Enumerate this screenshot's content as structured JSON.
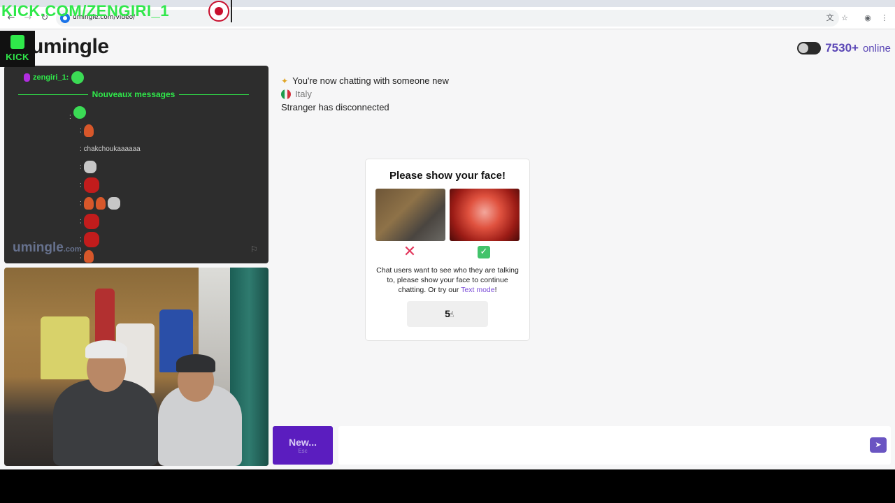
{
  "browser": {
    "url": "umingle.com/video/"
  },
  "stream_overlay": {
    "banner": "KICK.COM/ZENGIRI_1",
    "kick_logo": "KICK"
  },
  "header": {
    "logo": "umingle",
    "online_count": "7530+",
    "online_label": "online"
  },
  "video_overlay": {
    "username": "zengiri_1:",
    "separator": "Nouveaux messages",
    "chat_line": ": chakchoukaaaaaa",
    "watermark": "umingle",
    "watermark_suffix": ".com"
  },
  "chat": {
    "messages": [
      {
        "icon": "sparkle-icon",
        "text": "You're now chatting with someone new"
      },
      {
        "icon": "italy-flag-icon",
        "text": "Italy"
      },
      {
        "text": "Stranger has disconnected"
      }
    ]
  },
  "modal": {
    "title": "Please show your face!",
    "text_before_link": "Chat users want to see who they are talking to, please show your face to continue chatting. Or try our ",
    "link_text": "Text mode",
    "text_after_link": "!",
    "countdown": "5"
  },
  "footer": {
    "new_button": "New...",
    "new_button_hint": "Esc"
  },
  "colors": {
    "accent": "#5b1dbf",
    "online": "#5b47b6",
    "kick_green": "#2fe84a",
    "reject": "#e2365b",
    "accept": "#42c36b"
  }
}
